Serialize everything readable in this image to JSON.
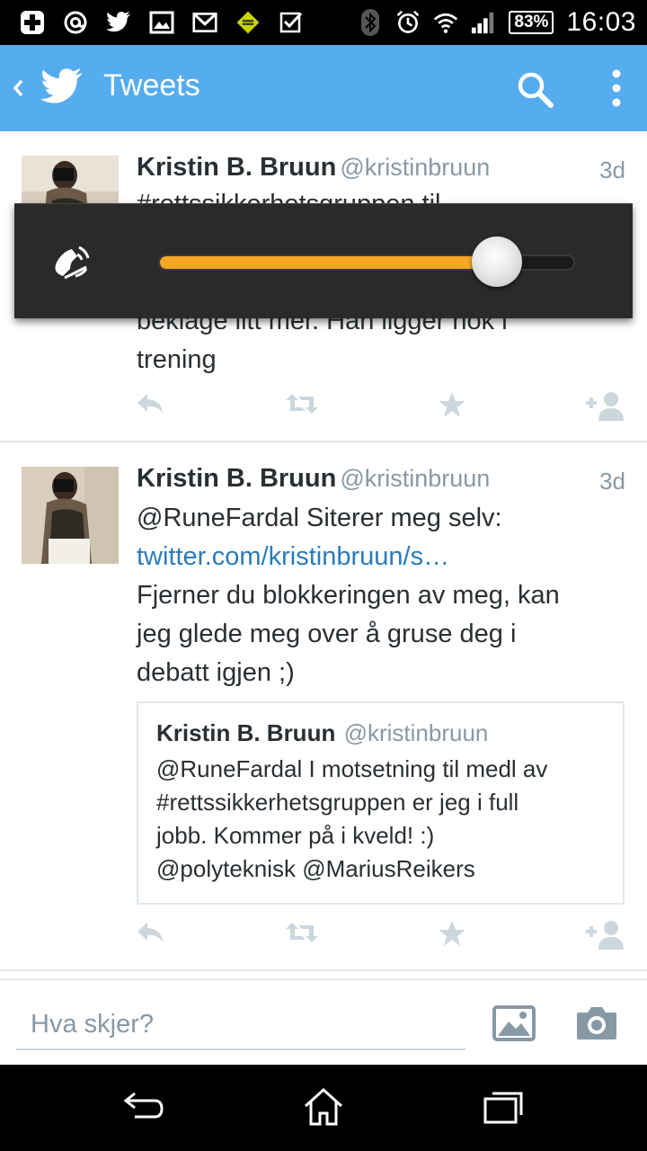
{
  "status_bar": {
    "left_icons": [
      "plus-badge-icon",
      "at-icon",
      "twitter-icon",
      "image-icon",
      "gmail-icon",
      "app-icon",
      "checkbox-icon"
    ],
    "right_icons": [
      "bluetooth-icon",
      "alarm-icon",
      "wifi-icon",
      "signal-icon"
    ],
    "battery": "83%",
    "time": "16:03"
  },
  "action_bar": {
    "title": "Tweets",
    "icons": [
      "back-chevron-icon",
      "twitter-bird-icon",
      "search-icon",
      "overflow-menu-icon"
    ],
    "color": "#55acee"
  },
  "volume_overlay": {
    "icon": "ringer-icon",
    "level_fraction": 0.82,
    "fill_color": "#f5a623"
  },
  "tweets": [
    {
      "name": "Kristin B. Bruun",
      "handle": "@kristinbruun",
      "time": "3d",
      "text_top": "#rettssikkerhetsgruppen til",
      "text_bottom_line1": "beklage litt mer. Han ligger nok i",
      "text_bottom_line2": "trening"
    },
    {
      "name": "Kristin B. Bruun",
      "handle": "@kristinbruun",
      "time": "3d",
      "text_line1": "@RuneFardal Siterer meg selv:",
      "link": "twitter.com/kristinbruun/s…",
      "text_line3": "Fjerner du blokkeringen av meg,  kan",
      "text_line4": "jeg glede meg over å gruse deg i",
      "text_line5": "debatt igjen ;)",
      "quote": {
        "name": "Kristin B. Bruun",
        "handle": "@kristinbruun",
        "line1": "@RuneFardal I motsetning til medl av",
        "line2": "#rettssikkerhetsgruppen er jeg i full",
        "line3": "jobb. Kommer på i kveld!  :)",
        "line4": "@polyteknisk @MariusReikers"
      }
    }
  ],
  "tweet_actions": [
    "reply-icon",
    "retweet-icon",
    "favorite-icon",
    "follow-icon"
  ],
  "compose": {
    "placeholder": "Hva skjer?",
    "icons": [
      "photo-icon",
      "camera-icon"
    ]
  },
  "nav_bar": {
    "icons": [
      "back-icon",
      "home-icon",
      "recents-icon"
    ]
  }
}
